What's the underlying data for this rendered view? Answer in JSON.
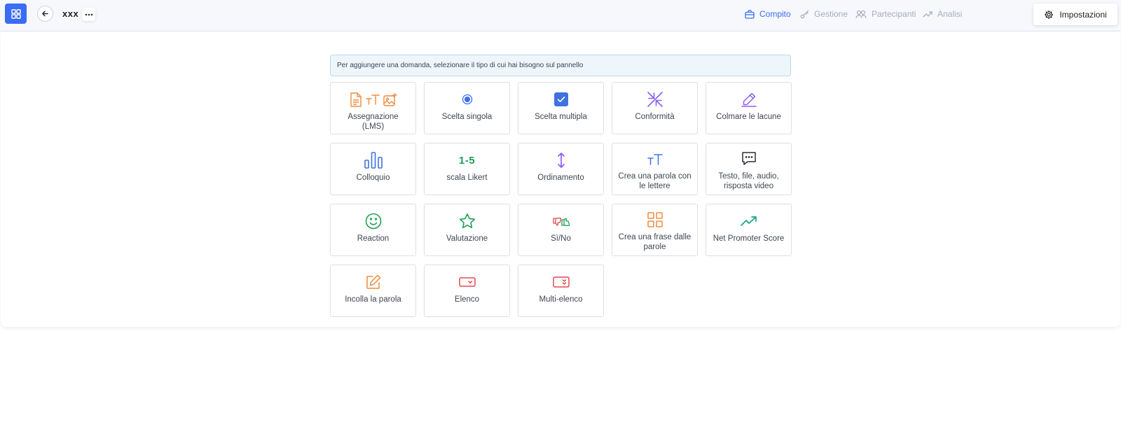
{
  "header": {
    "title": "xxx",
    "nav": [
      {
        "label": "Compito",
        "icon": "briefcase-icon",
        "active": true
      },
      {
        "label": "Gestione",
        "icon": "key-icon",
        "active": false
      },
      {
        "label": "Partecipanti",
        "icon": "users-icon",
        "active": false
      },
      {
        "label": "Analisi",
        "icon": "trending-icon",
        "active": false
      }
    ],
    "settings_label": "Impostazioni"
  },
  "hint": "Per aggiungere una domanda, selezionare il tipo di cui hai bisogno sul pannello",
  "tiles": [
    {
      "label": "Assegnazione (LMS)",
      "icon": "assignment-icons"
    },
    {
      "label": "Scelta singola",
      "icon": "radio-icon"
    },
    {
      "label": "Scelta multipla",
      "icon": "checkbox-icon"
    },
    {
      "label": "Conformità",
      "icon": "arrows-in-icon"
    },
    {
      "label": "Colmare le lacune",
      "icon": "pencil-icon"
    },
    {
      "label": "Colloquio",
      "icon": "bar-chart-icon"
    },
    {
      "label": "scala Likert",
      "icon": "likert-icon",
      "icon_text": "1-5"
    },
    {
      "label": "Ordinamento",
      "icon": "sort-arrows-icon"
    },
    {
      "label": "Crea una parola con le lettere",
      "icon": "text-size-icon"
    },
    {
      "label": "Testo, file, audio, risposta video",
      "icon": "message-icon"
    },
    {
      "label": "Reaction",
      "icon": "smile-icon"
    },
    {
      "label": "Valutazione",
      "icon": "star-icon"
    },
    {
      "label": "Sì/No",
      "icon": "thumbs-icon"
    },
    {
      "label": "Crea una frase dalle parole",
      "icon": "grid-icon"
    },
    {
      "label": "Net Promoter Score",
      "icon": "trend-up-icon"
    },
    {
      "label": "Incolla la parola",
      "icon": "edit-icon"
    },
    {
      "label": "Elenco",
      "icon": "dropdown-icon"
    },
    {
      "label": "Multi-elenco",
      "icon": "multi-dropdown-icon"
    }
  ],
  "colors": {
    "accent": "#3b6cf4",
    "orange": "#f08a3c",
    "purple": "#8b5cf6",
    "green": "#1e9f55",
    "red": "#e5484d",
    "teal": "#14a38b"
  }
}
